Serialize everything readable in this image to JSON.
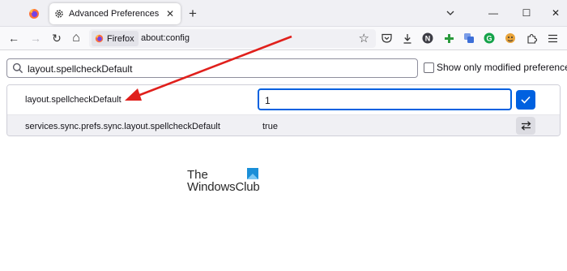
{
  "tabs": [
    {
      "kind": "pinned",
      "icon": "firefox-logo-icon"
    },
    {
      "kind": "active",
      "icon": "gear-icon",
      "title": "Advanced Preferences",
      "close": "✕"
    }
  ],
  "new_tab_label": "+",
  "window_controls": {
    "minimize": "—",
    "maximize": "☐",
    "close": "✕"
  },
  "navbar": {
    "back": "←",
    "forward": "→",
    "reload": "↻",
    "home": "⌂",
    "identity_label": "Firefox",
    "url": "about:config",
    "bookmark_star": "☆",
    "toolbar_icons": [
      "pocket-icon",
      "downloads-icon",
      "extension-n-icon",
      "extension-green-plus-icon",
      "extension-translate-icon",
      "grammarly-icon",
      "extension-tiger-icon",
      "extensions-icon",
      "menu-icon"
    ],
    "extension_n_letter": "N",
    "grammarly_letter": "G"
  },
  "config": {
    "search_value": "layout.spellcheckDefault",
    "only_modified_label": "Show only modified preferences",
    "only_modified_checked": false,
    "rows": [
      {
        "name": "layout.spellcheckDefault",
        "value": "1",
        "editing": true
      },
      {
        "name": "services.sync.prefs.sync.layout.spellcheckDefault",
        "value": "true",
        "editing": false
      }
    ]
  },
  "watermark": {
    "line1": "The",
    "line2": "WindowsClub"
  },
  "colors": {
    "accent": "#0061e0",
    "annotation_arrow": "#e0201c",
    "tabstrip_bg": "#f0f0f4"
  }
}
